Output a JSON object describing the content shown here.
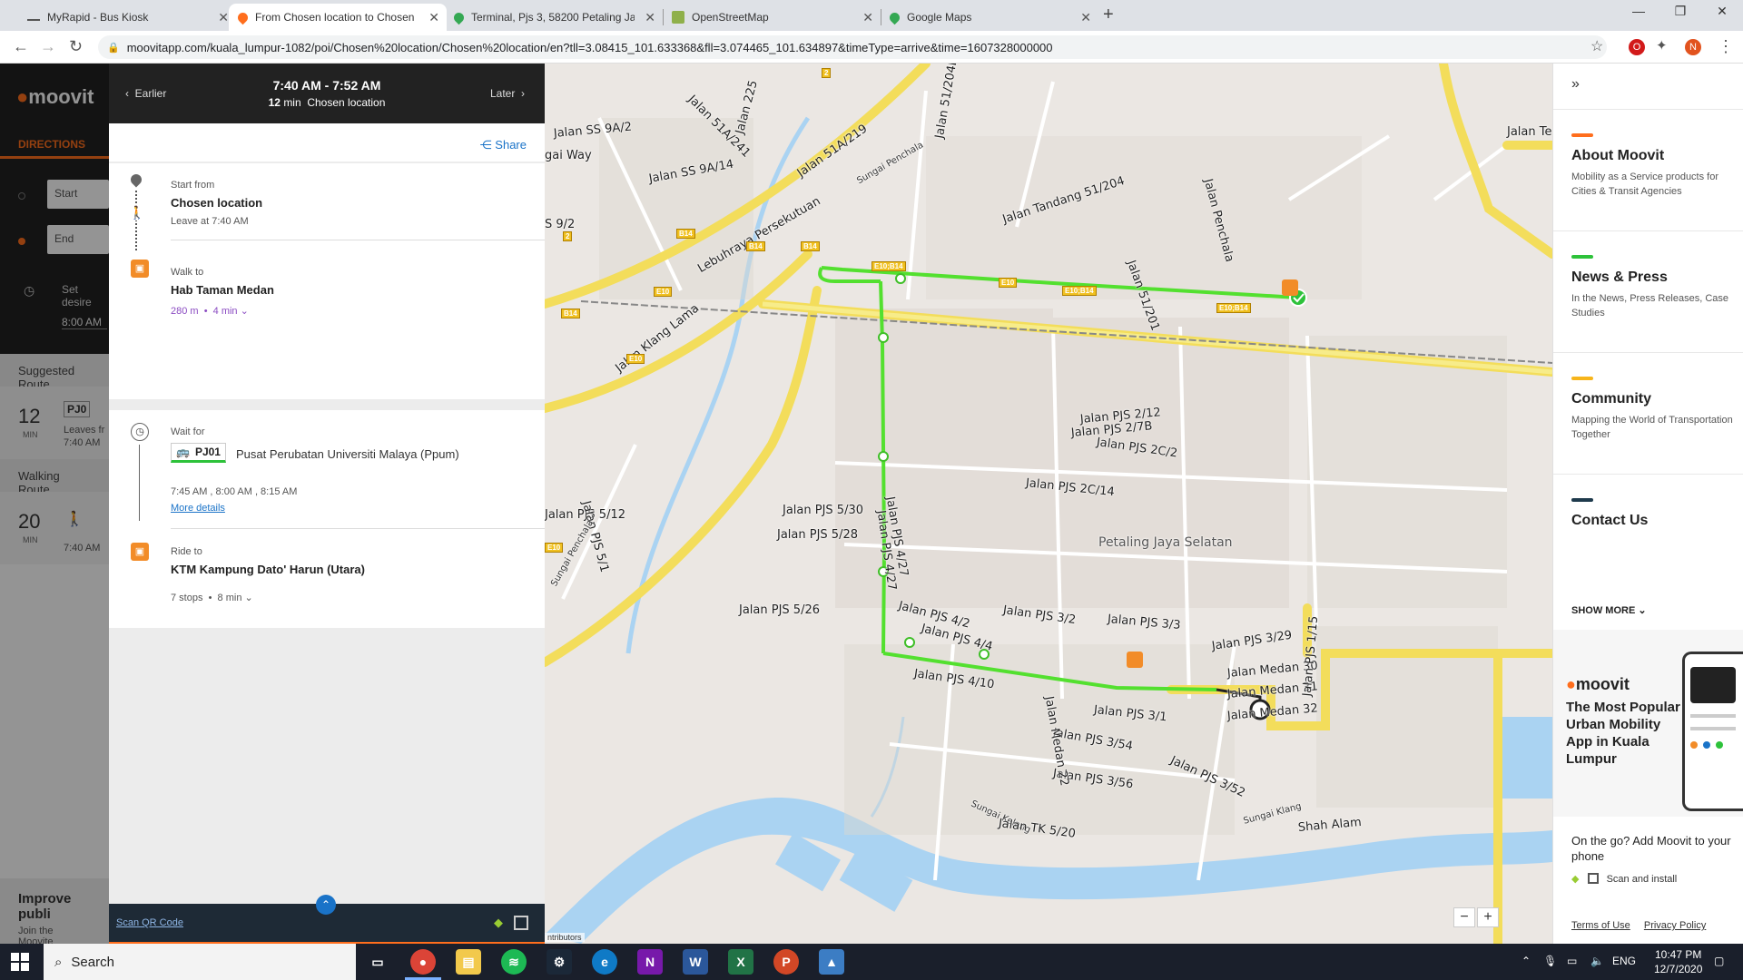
{
  "browser": {
    "tabs": [
      {
        "label": "MyRapid - Bus Kiosk",
        "icon": "mini-icon"
      },
      {
        "label": "From Chosen location to Chosen",
        "icon": "moovit-pin-icon"
      },
      {
        "label": "Terminal, Pjs 3, 58200 Petaling Ja",
        "icon": "maps-pin-icon"
      },
      {
        "label": "OpenStreetMap",
        "icon": "osm-icon"
      },
      {
        "label": "Google Maps",
        "icon": "maps-pin-icon"
      }
    ],
    "url": "moovitapp.com/kuala_lumpur-1082/poi/Chosen%20location/Chosen%20location/en?tll=3.08415_101.633368&fll=3.074465_101.634897&timeType=arrive&time=1607328000000",
    "profile_initial": "N"
  },
  "leftapp": {
    "logo": "moovit",
    "directions_tab": "DIRECTIONS",
    "start_placeholder": "Start",
    "end_placeholder": "End",
    "set_desired": "Set desire",
    "time_value": "8:00 AM",
    "suggested_routes": "Suggested Route",
    "route1": {
      "minutes": "12",
      "min_label": "MIN",
      "line": "PJ0",
      "leaves": "Leaves fr",
      "time": "7:40 AM"
    },
    "walking_route": "Walking Route",
    "route2": {
      "minutes": "20",
      "min_label": "MIN",
      "time": "7:40 AM"
    },
    "improve": {
      "title": "Improve publi",
      "sub": "Join the Moovite"
    }
  },
  "panel": {
    "earlier": "Earlier",
    "later": "Later",
    "time_range": "7:40 AM  -  7:52 AM",
    "duration": "12",
    "duration_unit": "min",
    "destination": "Chosen location",
    "share": "Share",
    "steps": {
      "start": {
        "label": "Start from",
        "title": "Chosen location",
        "sub": "Leave at 7:40 AM"
      },
      "walk": {
        "label": "Walk to",
        "title": "Hab Taman Medan",
        "distance": "280 m",
        "duration": "4 min"
      },
      "wait": {
        "label": "Wait for",
        "line": "PJ01",
        "headsign": "Pusat Perubatan Universiti Malaya (Ppum)",
        "times": "7:45 AM , 8:00 AM , 8:15 AM",
        "more": "More details"
      },
      "ride": {
        "label": "Ride to",
        "title": "KTM Kampung Dato' Harun (Utara)",
        "stops": "7 stops",
        "duration": "8 min"
      }
    },
    "footer": {
      "scan_qr": "Scan QR Code"
    }
  },
  "map": {
    "labels": [
      {
        "text": "Jalan SS 9A/2"
      },
      {
        "text": "Jalan SS 9A/14"
      },
      {
        "text": "Jalan 51A/241"
      },
      {
        "text": "Jalan 225"
      },
      {
        "text": "Jalan 51A/219"
      },
      {
        "text": "Lebuhraya Persekutuan"
      },
      {
        "text": "Sungai Penchala"
      },
      {
        "text": "Jalan 51/204B"
      },
      {
        "text": "Jalan Tandang 51/204"
      },
      {
        "text": "Jalan 51/201"
      },
      {
        "text": "Jalan Penchala"
      },
      {
        "text": "Jalan Klang Lama"
      },
      {
        "text": "Jalan PJS 2C/2"
      },
      {
        "text": "Jalan PJS 2C/14"
      },
      {
        "text": "Jalan PJS 2/12"
      },
      {
        "text": "Jalan PJS 2/7B"
      },
      {
        "text": "Jalan PJS 4/27"
      },
      {
        "text": "Jalan PJS 5/30"
      },
      {
        "text": "Jalan PJS 5/28"
      },
      {
        "text": "Jalan PJS 5/12"
      },
      {
        "text": "Jalan PJS 5/1"
      },
      {
        "text": "Petaling Jaya Selatan"
      },
      {
        "text": "Jalan PJS 5/26"
      },
      {
        "text": "Jalan PJS 4/2"
      },
      {
        "text": "Jalan PJS 4/4"
      },
      {
        "text": "Jalan PJS 3/2"
      },
      {
        "text": "Jalan PJS 3/3"
      },
      {
        "text": "Jalan PJS 4/10"
      },
      {
        "text": "Jalan PJS 3/1"
      },
      {
        "text": "Jalan PJS 3/54"
      },
      {
        "text": "Jalan PJS 3/52"
      },
      {
        "text": "Jalan PJS 3/56"
      },
      {
        "text": "Jalan PJS 3/29"
      },
      {
        "text": "Jalan Medan 30"
      },
      {
        "text": "Jalan Medan 31"
      },
      {
        "text": "Jalan Medan 32"
      },
      {
        "text": "Jalan Medan 22"
      },
      {
        "text": "Jalan PJS 1/15"
      },
      {
        "text": "Sungai Kelang"
      },
      {
        "text": "Sungai Klang"
      },
      {
        "text": "Jalan TK 5/20"
      },
      {
        "text": "Shah Alam"
      },
      {
        "text": "Jalan PJS 4/27"
      },
      {
        "text": "Sungai Penchala"
      },
      {
        "text": "gai Way"
      },
      {
        "text": "S 9/2"
      },
      {
        "text": "Jalan Te"
      }
    ],
    "shields": [
      "B14",
      "B14",
      "B14",
      "E10;B14",
      "E10",
      "E10;B14",
      "E10;B14",
      "E10",
      "E10",
      "B14",
      "E10",
      "2",
      "2"
    ],
    "attribution": "ntributors",
    "zoom_out": "−",
    "zoom_in": "+",
    "colors": {
      "route": "#53e02f",
      "road": "#f6e774",
      "water": "#aad3f2",
      "land": "#eaeaea"
    }
  },
  "rside": {
    "items": [
      {
        "title": "About Moovit",
        "desc": "Mobility as a Service products for Cities & Transit Agencies",
        "color": "#ff6e1d"
      },
      {
        "title": "News & Press",
        "desc": "In the News, Press Releases, Case Studies",
        "color": "#2dc23a"
      },
      {
        "title": "Community",
        "desc": "Mapping the World of Transportation Together",
        "color": "#f7b51b"
      },
      {
        "title": "Contact Us",
        "desc": "",
        "color": "#1e3a4c"
      }
    ],
    "show_more": "SHOW MORE",
    "promo_logo": "moovit",
    "promo_text": "The Most Popular Urban Mobility App in Kuala Lumpur",
    "onthego": "On the go? Add Moovit to your phone",
    "scan_install": "Scan and install",
    "terms": "Terms of Use",
    "privacy": "Privacy Policy"
  },
  "taskbar": {
    "search": "Search",
    "lang": "ENG",
    "time": "10:47 PM",
    "date": "12/7/2020"
  }
}
